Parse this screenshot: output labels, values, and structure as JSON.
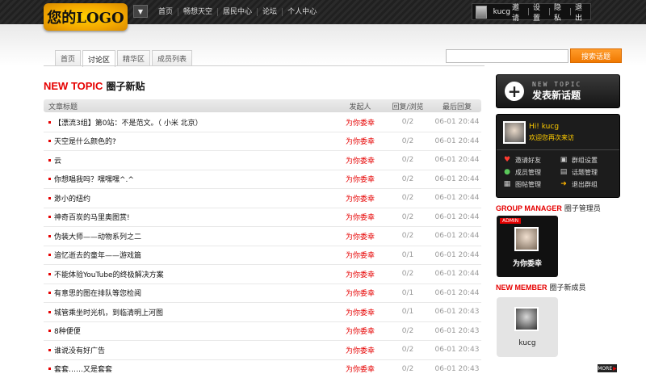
{
  "header": {
    "logo": "您的LOGO",
    "dropdown_icon": "caret-down",
    "nav": [
      {
        "label": "首页"
      },
      {
        "label": "畅想天空"
      },
      {
        "label": "居民中心"
      },
      {
        "label": "论坛"
      },
      {
        "label": "个人中心"
      }
    ],
    "user": {
      "name": "kucg",
      "links": [
        "邀请",
        "设置",
        "隐私",
        "退出"
      ]
    }
  },
  "tabs": [
    {
      "label": "首页",
      "active": false
    },
    {
      "label": "讨论区",
      "active": true
    },
    {
      "label": "精华区",
      "active": false
    },
    {
      "label": "成员列表",
      "active": false
    }
  ],
  "search": {
    "value": "",
    "button_label": "搜索话题"
  },
  "heading": {
    "en": "NEW TOPIC",
    "cn": "圈子新贴"
  },
  "table": {
    "columns": [
      "文章标题",
      "发起人",
      "回复/浏览",
      "最后回复"
    ],
    "rows": [
      {
        "title": "【漂流3组】第0站：不是范文。（ 小米  北京）",
        "author": "为你委幸",
        "reply": "0/2",
        "last": "06-01 20:44"
      },
      {
        "title": "天空是什么颜色的?",
        "author": "为你委幸",
        "reply": "0/2",
        "last": "06-01 20:44"
      },
      {
        "title": "云",
        "author": "为你委幸",
        "reply": "0/2",
        "last": "06-01 20:44"
      },
      {
        "title": "你想唱我吗？嘿嘿嘿^.^",
        "author": "为你委幸",
        "reply": "0/2",
        "last": "06-01 20:44"
      },
      {
        "title": "渺小的纽约",
        "author": "为你委幸",
        "reply": "0/2",
        "last": "06-01 20:44"
      },
      {
        "title": "神奇百炭的马里奥图赏!",
        "author": "为你委幸",
        "reply": "0/2",
        "last": "06-01 20:44"
      },
      {
        "title": "伪装大师——动物系列之二",
        "author": "为你委幸",
        "reply": "0/2",
        "last": "06-01 20:44"
      },
      {
        "title": "追忆逝去的童年——游戏篇",
        "author": "为你委幸",
        "reply": "0/1",
        "last": "06-01 20:44"
      },
      {
        "title": "不能体验YouTube的终极解决方案",
        "author": "为你委幸",
        "reply": "0/2",
        "last": "06-01 20:44"
      },
      {
        "title": "有意思的图在排队等您检阅",
        "author": "为你委幸",
        "reply": "0/1",
        "last": "06-01 20:44"
      },
      {
        "title": "城管乘坐时光机，到临清明上河图",
        "author": "为你委幸",
        "reply": "0/1",
        "last": "06-01 20:43"
      },
      {
        "title": "8种便便",
        "author": "为你委幸",
        "reply": "0/2",
        "last": "06-01 20:43"
      },
      {
        "title": "谁说没有好广告",
        "author": "为你委幸",
        "reply": "0/2",
        "last": "06-01 20:43"
      },
      {
        "title": "套套……又是套套",
        "author": "为你委幸",
        "reply": "0/2",
        "last": "06-01 20:43"
      }
    ]
  },
  "sidebar": {
    "new_topic": {
      "en": "NEW TOPIC",
      "cn": "发表新话题"
    },
    "userbox": {
      "hi": "Hi! kucg",
      "welcome": "欢迎您再次来访",
      "actions": [
        {
          "label": "邀请好友",
          "icon": "heart-icon",
          "color": "#ff3b30"
        },
        {
          "label": "群组设置",
          "icon": "settings-icon",
          "color": "#cccccc"
        },
        {
          "label": "成员管理",
          "icon": "members-icon",
          "color": "#5ac85a"
        },
        {
          "label": "话题管理",
          "icon": "topic-icon",
          "color": "#cccccc"
        },
        {
          "label": "图帖管理",
          "icon": "image-icon",
          "color": "#cccccc"
        },
        {
          "label": "退出群组",
          "icon": "exit-icon",
          "color": "#ffb400"
        }
      ]
    },
    "manager": {
      "title_en": "GROUP MANAGER",
      "title_cn": "圈子管理员",
      "badge": "ADMIN",
      "name": "为你委幸"
    },
    "members": {
      "title_en": "NEW MEMBER",
      "title_cn": "圈子新成员",
      "name": "kucg"
    },
    "more": "MORE"
  },
  "colors": {
    "accent": "#e60000",
    "orange": "#f07800",
    "dark": "#1c1c1c"
  }
}
